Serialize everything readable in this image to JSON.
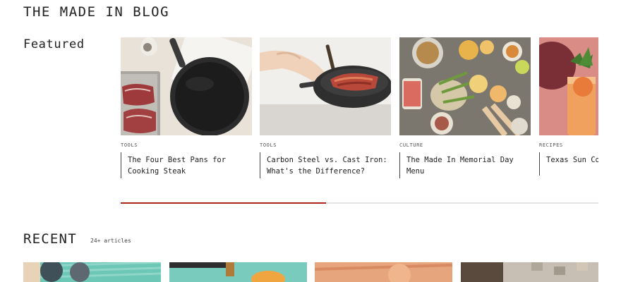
{
  "header": {
    "title": "THE MADE IN BLOG"
  },
  "featured": {
    "label": "Featured",
    "cards": [
      {
        "category": "TOOLS",
        "title": "The Four Best Pans for\nCooking Steak",
        "image": "carbon-steel-pan-with-steaks"
      },
      {
        "category": "TOOLS",
        "title": "Carbon Steel vs. Cast Iron:\nWhat's the Difference?",
        "image": "pan-with-bacon"
      },
      {
        "category": "CULTURE",
        "title": "The Made In Memorial Day\nMenu",
        "image": "outdoor-table-spread"
      },
      {
        "category": "RECIPES",
        "title": "Texas Sun Co",
        "image": "cocktail-glass"
      }
    ],
    "progress": 0.43
  },
  "recent": {
    "label": "RECENT",
    "count": "24+ articles",
    "thumbs": [
      "teal-table-thumb",
      "teal-drink-thumb",
      "orange-bowl-thumb",
      "tiled-floor-thumb"
    ]
  },
  "colors": {
    "accent": "#b0251e",
    "track": "#e3e3e3"
  }
}
